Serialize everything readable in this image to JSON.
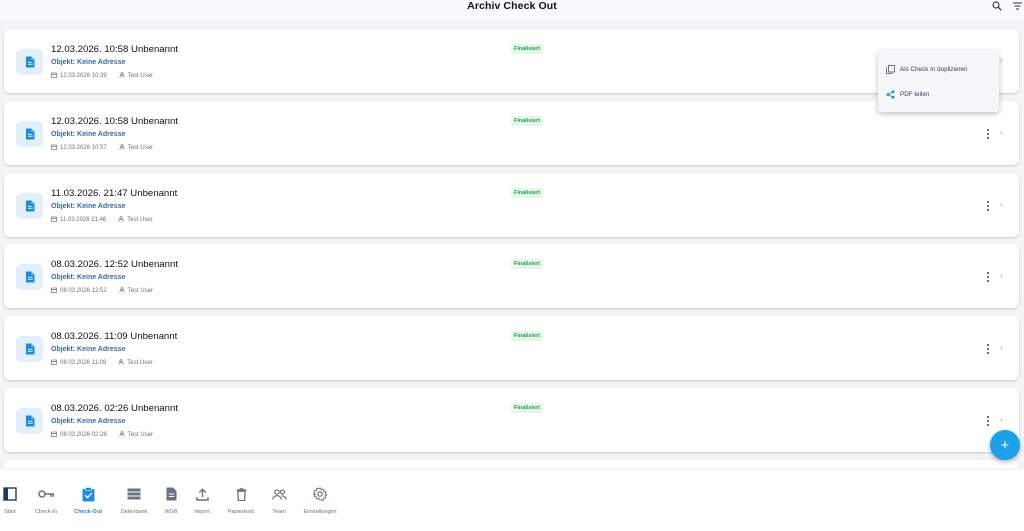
{
  "header": {
    "title": "Archiv Check Out",
    "search_icon": "search-icon",
    "sort_icon": "sort-icon"
  },
  "records": [
    {
      "title": "12.03.2026. 10:58 Unbenannt",
      "object": "Objekt: Keine Adresse",
      "date": "12.03.2026 10:39",
      "user": "Test User",
      "status": "Finalisiert"
    },
    {
      "title": "12.03.2026. 10:58 Unbenannt",
      "object": "Objekt: Keine Adresse",
      "date": "12.03.2026 10:57",
      "user": "Test User",
      "status": "Finalisiert"
    },
    {
      "title": "11.03.2026. 21:47 Unbenannt",
      "object": "Objekt: Keine Adresse",
      "date": "11.03.2026 21:46",
      "user": "Test User",
      "status": "Finalisiert"
    },
    {
      "title": "08.03.2026. 12:52 Unbenannt",
      "object": "Objekt: Keine Adresse",
      "date": "08.03.2026 12:52",
      "user": "Test User",
      "status": "Finalisiert"
    },
    {
      "title": "08.03.2026. 11:09 Unbenannt",
      "object": "Objekt: Keine Adresse",
      "date": "08.03.2026 11:09",
      "user": "Test User",
      "status": "Finalisiert"
    },
    {
      "title": "08.03.2026. 02:26 Unbenannt",
      "object": "Objekt: Keine Adresse",
      "date": "08.03.2026 02:26",
      "user": "Test User",
      "status": "Finalisiert"
    }
  ],
  "context_menu": {
    "items": [
      {
        "label": "Als Check In duplizieren",
        "icon": "copy-icon"
      },
      {
        "label": "PDF teilen",
        "icon": "share-icon"
      }
    ]
  },
  "fab": {
    "icon": "plus-icon",
    "label": "+"
  },
  "bottom_nav": {
    "items": [
      {
        "label": "Start",
        "icon": "sidebar-toggle-icon"
      },
      {
        "label": "Check-In",
        "icon": "key-icon"
      },
      {
        "label": "Check-Out",
        "icon": "clipboard-check-icon",
        "active": true
      },
      {
        "label": "Datenbank",
        "icon": "database-icon"
      },
      {
        "label": "WGB",
        "icon": "document-icon"
      },
      {
        "label": "Import",
        "icon": "upload-icon"
      },
      {
        "label": "Papierkorb",
        "icon": "trash-icon"
      },
      {
        "label": "Team",
        "icon": "team-icon"
      },
      {
        "label": "Einstellungen",
        "icon": "gear-icon"
      }
    ]
  },
  "colors": {
    "accent": "#1d8ce0",
    "status_green": "#22a052",
    "object_text": "#3b6b9e",
    "fab": "#1da1e8"
  }
}
